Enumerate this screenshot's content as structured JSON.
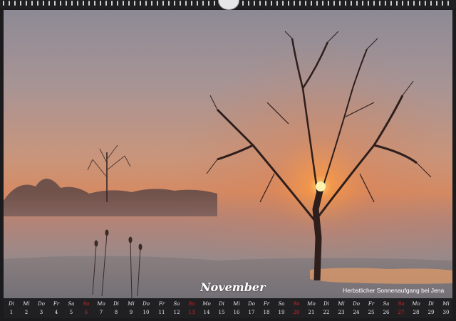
{
  "calendar": {
    "month": "November",
    "caption": "Herbstlicher Sonnenaufgang bei Jena",
    "days": [
      {
        "wd": "Di",
        "d": "1"
      },
      {
        "wd": "Mi",
        "d": "2"
      },
      {
        "wd": "Do",
        "d": "3"
      },
      {
        "wd": "Fr",
        "d": "4"
      },
      {
        "wd": "Sa",
        "d": "5"
      },
      {
        "wd": "So",
        "d": "6",
        "sunday": true
      },
      {
        "wd": "Mo",
        "d": "7"
      },
      {
        "wd": "Di",
        "d": "8"
      },
      {
        "wd": "Mi",
        "d": "9"
      },
      {
        "wd": "Do",
        "d": "10"
      },
      {
        "wd": "Fr",
        "d": "11"
      },
      {
        "wd": "Sa",
        "d": "12"
      },
      {
        "wd": "So",
        "d": "13",
        "sunday": true
      },
      {
        "wd": "Mo",
        "d": "14"
      },
      {
        "wd": "Di",
        "d": "15"
      },
      {
        "wd": "Mi",
        "d": "16"
      },
      {
        "wd": "Do",
        "d": "17"
      },
      {
        "wd": "Fr",
        "d": "18"
      },
      {
        "wd": "Sa",
        "d": "19"
      },
      {
        "wd": "So",
        "d": "20",
        "sunday": true
      },
      {
        "wd": "Mo",
        "d": "21"
      },
      {
        "wd": "Di",
        "d": "22"
      },
      {
        "wd": "Mi",
        "d": "23"
      },
      {
        "wd": "Do",
        "d": "24"
      },
      {
        "wd": "Fr",
        "d": "25"
      },
      {
        "wd": "Sa",
        "d": "26"
      },
      {
        "wd": "So",
        "d": "27",
        "sunday": true
      },
      {
        "wd": "Mo",
        "d": "28"
      },
      {
        "wd": "Di",
        "d": "29"
      },
      {
        "wd": "Mi",
        "d": "30"
      }
    ]
  },
  "colors": {
    "sunday": "#e02020",
    "text": "#e8e8ea",
    "sun": "#ffe070"
  }
}
